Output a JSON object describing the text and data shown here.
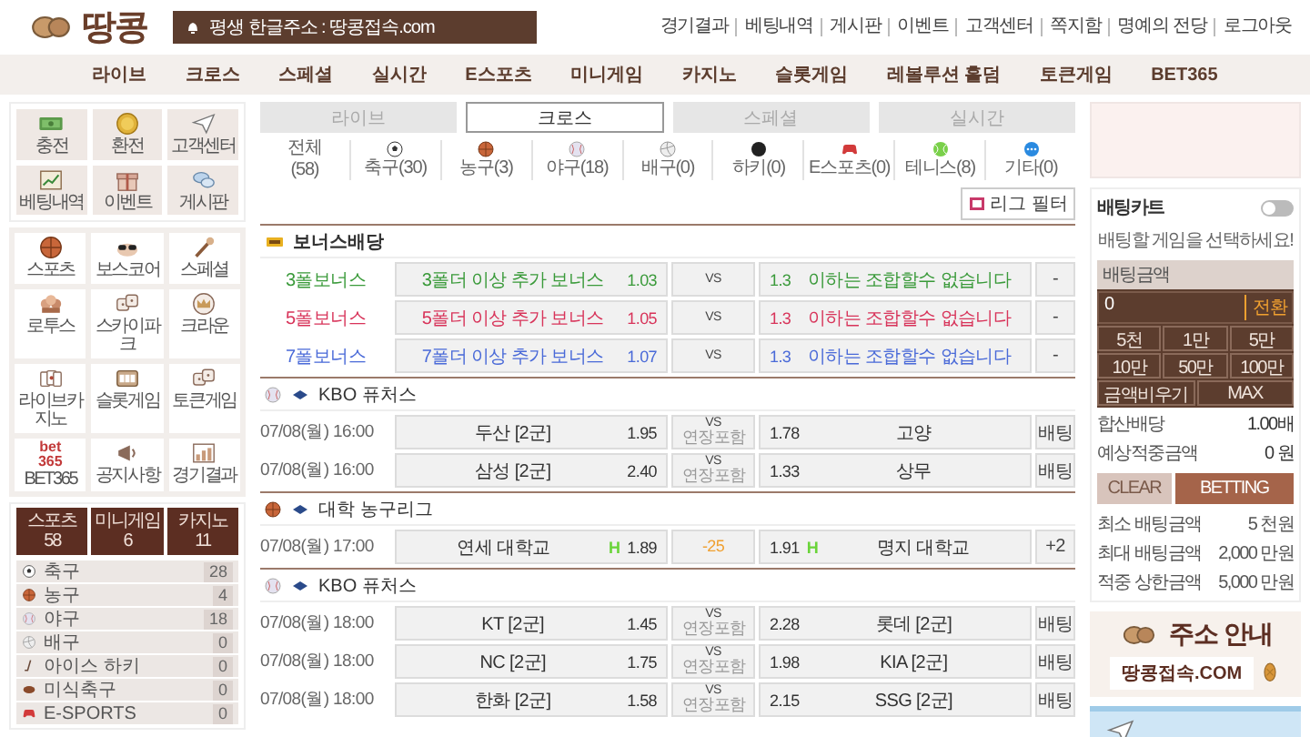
{
  "header": {
    "logo": "땅콩",
    "notice": "평생 한글주소 : 땅콩접속.com",
    "links": [
      "경기결과",
      "베팅내역",
      "게시판",
      "이벤트",
      "고객센터",
      "쪽지함",
      "명예의 전당",
      "로그아웃"
    ]
  },
  "nav": [
    "라이브",
    "크로스",
    "스페셜",
    "실시간",
    "E스포츠",
    "미니게임",
    "카지노",
    "슬롯게임",
    "레볼루션 홀덤",
    "토큰게임",
    "BET365"
  ],
  "left": {
    "shortcuts": [
      "충전",
      "환전",
      "고객센터",
      "베팅내역",
      "이벤트",
      "게시판"
    ],
    "games": [
      {
        "label": "스포츠"
      },
      {
        "label": "보스코어"
      },
      {
        "label": "스페셜"
      },
      {
        "label": "로투스"
      },
      {
        "label": "스카이파크"
      },
      {
        "label": "크라운"
      },
      {
        "label": "라이브카지노"
      },
      {
        "label": "슬롯게임"
      },
      {
        "label": "토큰게임"
      },
      {
        "label": "BET365",
        "logo": [
          "bet",
          "365"
        ]
      },
      {
        "label": "공지사항"
      },
      {
        "label": "경기결과"
      }
    ],
    "tabs": [
      {
        "label": "스포츠",
        "count": "58"
      },
      {
        "label": "미니게임",
        "count": "6"
      },
      {
        "label": "카지노",
        "count": "11"
      }
    ],
    "sports": [
      {
        "name": "축구",
        "count": "28"
      },
      {
        "name": "농구",
        "count": "4"
      },
      {
        "name": "야구",
        "count": "18"
      },
      {
        "name": "배구",
        "count": "0"
      },
      {
        "name": "아이스 하키",
        "count": "0"
      },
      {
        "name": "미식축구",
        "count": "0"
      },
      {
        "name": "E-SPORTS",
        "count": "0"
      }
    ]
  },
  "main": {
    "tabs": [
      {
        "label": "라이브",
        "selected": false
      },
      {
        "label": "크로스",
        "selected": true
      },
      {
        "label": "스페셜",
        "selected": false
      },
      {
        "label": "실시간",
        "selected": false
      }
    ],
    "filters": [
      {
        "label": "전체",
        "count": "(58)"
      },
      {
        "label": "축구(30)"
      },
      {
        "label": "농구(3)"
      },
      {
        "label": "야구(18)"
      },
      {
        "label": "배구(0)"
      },
      {
        "label": "하키(0)"
      },
      {
        "label": "E스포츠(0)"
      },
      {
        "label": "테니스(8)"
      },
      {
        "label": "기타(0)"
      }
    ],
    "league_filter": "리그 필터",
    "bonus": {
      "title": "보너스배당",
      "rows": [
        {
          "label": "3폴보너스",
          "color": "#3a9a3a",
          "home": "3폴더 이상 추가 보너스",
          "home_odds": "1.03",
          "center": "VS",
          "away_odds": "1.3",
          "away": "이하는 조합할수 없습니다",
          "action": "-"
        },
        {
          "label": "5폴보너스",
          "color": "#d8345a",
          "home": "5폴더 이상 추가 보너스",
          "home_odds": "1.05",
          "center": "VS",
          "away_odds": "1.3",
          "away": "이하는 조합할수 없습니다",
          "action": "-"
        },
        {
          "label": "7폴보너스",
          "color": "#4a6ad8",
          "home": "7폴더 이상 추가 보너스",
          "home_odds": "1.07",
          "center": "VS",
          "away_odds": "1.3",
          "away": "이하는 조합할수 없습니다",
          "action": "-"
        }
      ]
    },
    "leagues": [
      {
        "kind": "baseball",
        "name": "KBO 퓨처스",
        "games": [
          {
            "kind": "match",
            "time": "07/08(월) 16:00",
            "home": "두산 [2군]",
            "home_odds": "1.95",
            "center": "VS",
            "center_note": "연장포함",
            "away_odds": "1.78",
            "away": "고양",
            "action": "배팅"
          },
          {
            "kind": "match",
            "time": "07/08(월) 16:00",
            "home": "삼성 [2군]",
            "home_odds": "2.40",
            "center": "VS",
            "center_note": "연장포함",
            "away_odds": "1.33",
            "away": "상무",
            "action": "배팅"
          }
        ]
      },
      {
        "kind": "basketball",
        "name": "대학 농구리그",
        "games": [
          {
            "kind": "handicap",
            "time": "07/08(월) 17:00",
            "home": "연세 대학교",
            "home_mark": "H",
            "home_odds": "1.89",
            "center": "-25",
            "away_odds": "1.91",
            "away_mark": "H",
            "away": "명지 대학교",
            "action": "+2"
          }
        ]
      },
      {
        "kind": "baseball",
        "name": "KBO 퓨처스",
        "games": [
          {
            "kind": "match",
            "time": "07/08(월) 18:00",
            "home": "KT [2군]",
            "home_odds": "1.45",
            "center": "VS",
            "center_note": "연장포함",
            "away_odds": "2.28",
            "away": "롯데 [2군]",
            "action": "배팅"
          },
          {
            "kind": "match",
            "time": "07/08(월) 18:00",
            "home": "NC [2군]",
            "home_odds": "1.75",
            "center": "VS",
            "center_note": "연장포함",
            "away_odds": "1.98",
            "away": "KIA [2군]",
            "action": "배팅"
          },
          {
            "kind": "match",
            "time": "07/08(월) 18:00",
            "home": "한화 [2군]",
            "home_odds": "1.58",
            "center": "VS",
            "center_note": "연장포함",
            "away_odds": "2.15",
            "away": "SSG [2군]",
            "action": "배팅"
          }
        ]
      }
    ]
  },
  "slip": {
    "title": "배팅카트",
    "cart_on": false,
    "message": "배팅할 게임을 선택하세요!",
    "amount_label": "배팅금액",
    "amount": "0",
    "convert": "전환",
    "chips": [
      "5천",
      "1만",
      "5만",
      "10만",
      "50만",
      "100만"
    ],
    "clear_amount": "금액비우기",
    "max": "MAX",
    "summary": [
      {
        "label": "합산배당",
        "value": "1.00배"
      },
      {
        "label": "예상적중금액",
        "value": "0 원"
      }
    ],
    "clear": "CLEAR",
    "bet": "BETTING",
    "limits": [
      {
        "label": "최소 배팅금액",
        "value": "5 천원"
      },
      {
        "label": "최대 배팅금액",
        "value": "2,000 만원"
      },
      {
        "label": "적중 상한금액",
        "value": "5,000 만원"
      }
    ],
    "banner": {
      "title": "주소 안내",
      "address": "땅콩접속.COM"
    }
  }
}
